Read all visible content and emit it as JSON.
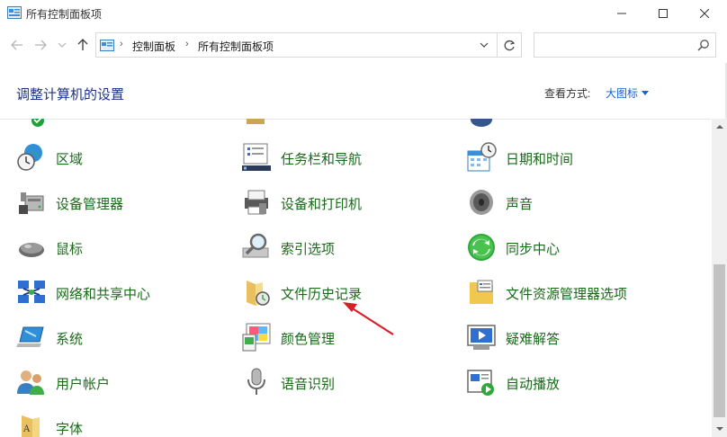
{
  "window": {
    "title": "所有控制面板项"
  },
  "nav": {
    "breadcrumbs": [
      "控制面板",
      "所有控制面板项"
    ],
    "search_placeholder": ""
  },
  "header": {
    "title": "调整计算机的设置",
    "view_by_label": "查看方式:",
    "view_by_value": "大图标"
  },
  "items": {
    "col1": [
      "区域",
      "设备管理器",
      "鼠标",
      "网络和共享中心",
      "系统",
      "用户帐户",
      "字体"
    ],
    "col2": [
      "任务栏和导航",
      "设备和打印机",
      "索引选项",
      "文件历史记录",
      "颜色管理",
      "语音识别"
    ],
    "col3": [
      "日期和时间",
      "声音",
      "同步中心",
      "文件资源管理器选项",
      "疑难解答",
      "自动播放"
    ]
  },
  "colors": {
    "link_green": "#1a6a1a",
    "title_blue": "#1e3287",
    "accent_blue": "#1a5fd0",
    "arrow_red": "#d81e2a"
  }
}
